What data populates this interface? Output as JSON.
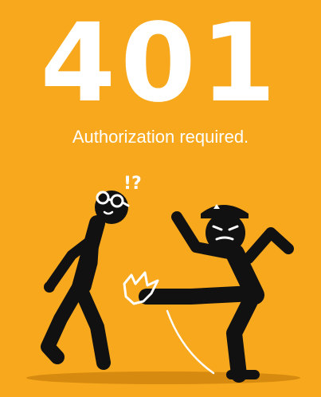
{
  "error": {
    "code": "401",
    "message": "Authorization required."
  },
  "illustration": {
    "exclamation": "!?",
    "description_icons": [
      "old-man-figure-icon",
      "police-officer-figure-icon",
      "kick-impact-burst-icon"
    ]
  },
  "colors": {
    "background": "#F7A81C",
    "text": "#FFFFFF",
    "figure": "#111111",
    "shadow": "#D68A0F"
  }
}
